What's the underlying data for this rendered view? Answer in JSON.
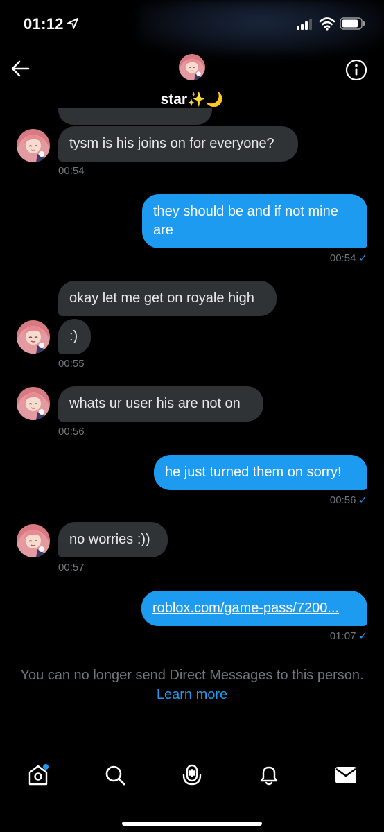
{
  "status_bar": {
    "time": "01:12"
  },
  "header": {
    "name": "star",
    "name_emoji": "✨🌙"
  },
  "messages": [
    {
      "text": "tysm is his joins on for everyone?",
      "direction": "incoming",
      "time": "00:54"
    },
    {
      "text": "they should be and if not mine are",
      "direction": "outgoing",
      "time": "00:54"
    },
    {
      "text": "okay let me get on royale high",
      "direction": "incoming",
      "time": ""
    },
    {
      "text": ":)",
      "direction": "incoming",
      "time": "00:55"
    },
    {
      "text": "whats ur user his are not on",
      "direction": "incoming",
      "time": "00:56"
    },
    {
      "text": "he just turned them on sorry!",
      "direction": "outgoing",
      "time": "00:56"
    },
    {
      "text": "no worries :))",
      "direction": "incoming",
      "time": "00:57"
    },
    {
      "text": "roblox.com/game-pass/7200...",
      "direction": "outgoing",
      "time": "01:07",
      "is_link": true
    }
  ],
  "read_check": "✓",
  "notice": {
    "text": "You can no longer send Direct Messages to this person.",
    "link": "Learn more"
  },
  "tabbar": {
    "items": [
      "home-icon",
      "search-icon",
      "spaces-icon",
      "notifications-icon",
      "messages-icon"
    ]
  },
  "colors": {
    "accent": "#1d9bf0",
    "incoming_bubble": "#2f3336",
    "background": "#000000"
  }
}
